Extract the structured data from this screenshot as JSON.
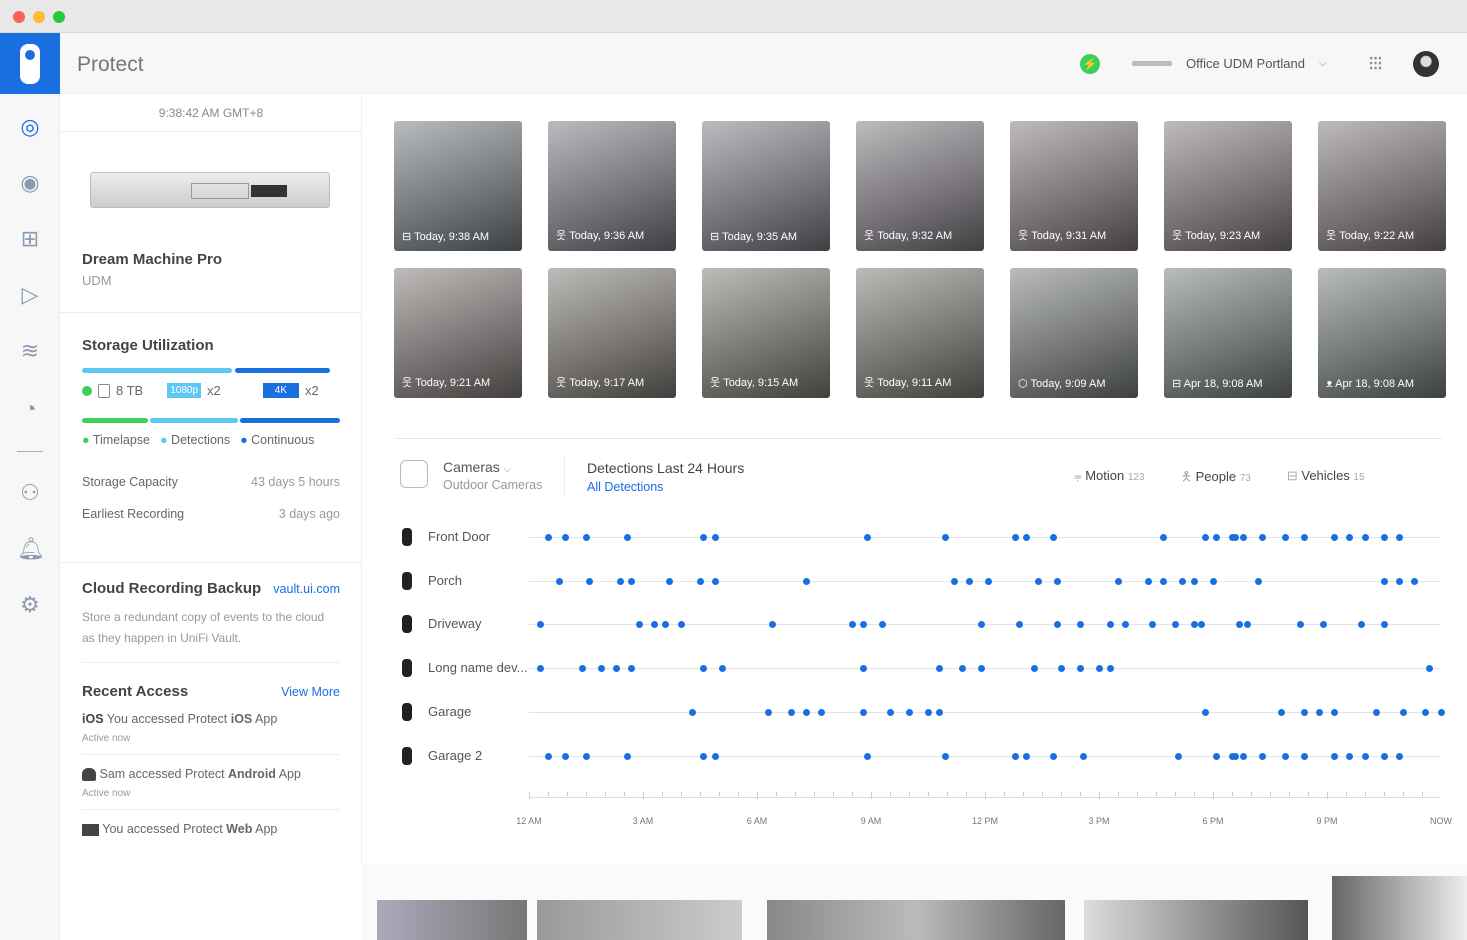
{
  "app": {
    "title": "Protect"
  },
  "header": {
    "console": "Office UDM Portland",
    "status_color": "#3ccf5a"
  },
  "left": {
    "time": "9:38:42 AM GMT+8",
    "device_name": "Dream Machine Pro",
    "device_model": "UDM",
    "storage": {
      "title": "Storage Utilization",
      "size": "8 TB",
      "res1": "1080p",
      "res1_count": "x2",
      "res2": "4K",
      "res2_count": "x2",
      "legend": [
        "Timelapse",
        "Detections",
        "Continuous"
      ],
      "capacity_label": "Storage Capacity",
      "capacity_value": "43 days 5 hours",
      "earliest_label": "Earliest Recording",
      "earliest_value": "3 days ago"
    },
    "cloud": {
      "title": "Cloud Recording Backup",
      "link": "vault.ui.com",
      "desc": "Store a redundant copy of events to the cloud as they happen in UniFi Vault."
    },
    "recent": {
      "title": "Recent Access",
      "link": "View More",
      "items": [
        {
          "icon": "ios",
          "badge": "iOS",
          "pre": "You accessed Protect ",
          "bold": "iOS",
          "post": " App",
          "time": "Active now"
        },
        {
          "icon": "android-icon",
          "pre": "Sam accessed Protect ",
          "bold": "Android",
          "post": " App",
          "time": "Active now"
        },
        {
          "icon": "monitor-icon",
          "pre": "You accessed Protect ",
          "bold": "Web",
          "post": " App",
          "time": ""
        }
      ]
    }
  },
  "thumbnails": [
    {
      "type": "vehicle",
      "label": "Today, 9:38 AM"
    },
    {
      "type": "person",
      "label": "Today, 9:36 AM"
    },
    {
      "type": "vehicle",
      "label": "Today, 9:35 AM"
    },
    {
      "type": "person",
      "label": "Today, 9:32 AM"
    },
    {
      "type": "person",
      "label": "Today, 9:31 AM"
    },
    {
      "type": "person",
      "label": "Today, 9:23 AM"
    },
    {
      "type": "person",
      "label": "Today, 9:22 AM"
    },
    {
      "type": "person",
      "label": "Today, 9:21 AM"
    },
    {
      "type": "person",
      "label": "Today, 9:17 AM"
    },
    {
      "type": "person",
      "label": "Today, 9:15 AM"
    },
    {
      "type": "person",
      "label": "Today, 9:11 AM"
    },
    {
      "type": "package",
      "label": "Today, 9:09 AM"
    },
    {
      "type": "vehicle",
      "label": "Apr 18, 9:08 AM"
    },
    {
      "type": "animal",
      "label": "Apr 18, 9:08 AM"
    }
  ],
  "detections": {
    "cameras_label": "Cameras",
    "cameras_sub": "Outdoor Cameras",
    "title": "Detections Last 24 Hours",
    "filter": "All Detections",
    "counts": [
      {
        "label": "Motion",
        "value": "123"
      },
      {
        "label": "People",
        "value": "73"
      },
      {
        "label": "Vehicles",
        "value": "15"
      }
    ],
    "ticks": [
      "12 AM",
      "3 AM",
      "6 AM",
      "9 AM",
      "12 PM",
      "3 PM",
      "6 PM",
      "9 PM",
      "NOW"
    ],
    "accent": "#1a6fe0",
    "rows": [
      {
        "name": "Front Door",
        "events": [
          0.5,
          0.95,
          1.5,
          2.6,
          4.6,
          4.9,
          8.9,
          10.95,
          12.8,
          13.1,
          13.8,
          16.7,
          17.8,
          18.1,
          18.5,
          18.6,
          18.8,
          19.3,
          19.9,
          20.4,
          21.2,
          21.6,
          22.0,
          22.5,
          22.9
        ]
      },
      {
        "name": "Porch",
        "events": [
          0.8,
          1.6,
          2.4,
          2.7,
          3.7,
          4.5,
          4.9,
          7.3,
          11.2,
          11.6,
          12.1,
          13.4,
          13.9,
          15.5,
          16.3,
          16.7,
          17.2,
          17.5,
          18.0,
          19.2,
          22.5,
          22.9,
          23.3
        ]
      },
      {
        "name": "Driveway",
        "events": [
          0.3,
          2.9,
          3.3,
          3.6,
          4.0,
          6.4,
          8.5,
          8.8,
          9.3,
          11.9,
          12.9,
          13.9,
          14.5,
          15.3,
          15.7,
          16.4,
          17.0,
          17.5,
          17.7,
          18.7,
          18.9,
          20.3,
          20.9,
          21.9,
          22.5
        ]
      },
      {
        "name": "Long name dev...",
        "events": [
          0.3,
          1.4,
          1.9,
          2.3,
          2.7,
          4.6,
          5.1,
          8.8,
          10.8,
          11.4,
          11.9,
          13.3,
          14.0,
          14.5,
          15.0,
          15.3,
          23.7
        ]
      },
      {
        "name": "Garage",
        "events": [
          4.3,
          6.3,
          6.9,
          7.3,
          7.7,
          8.8,
          9.5,
          10.0,
          10.5,
          10.8,
          17.8,
          19.8,
          20.4,
          20.8,
          21.2,
          22.3,
          23.0,
          23.6,
          24.0
        ]
      },
      {
        "name": "Garage 2",
        "events": [
          0.5,
          0.95,
          1.5,
          2.6,
          4.6,
          4.9,
          8.9,
          10.95,
          12.8,
          13.1,
          13.8,
          14.6,
          17.1,
          18.1,
          18.5,
          18.6,
          18.8,
          19.3,
          19.9,
          20.4,
          21.2,
          21.6,
          22.0,
          22.5,
          22.9
        ]
      }
    ]
  }
}
